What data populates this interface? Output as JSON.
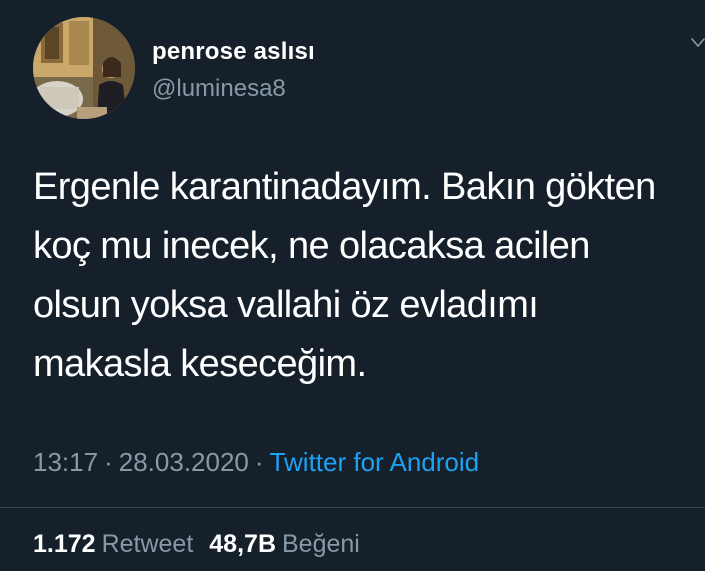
{
  "tweet": {
    "display_name": "penrose aslısı",
    "handle": "@luminesa8",
    "text": "Ergenle karantinadayım. Bakın gökten\nkoç mu inecek, ne olacaksa acilen\nolsun yoksa vallahi öz evladımı\nmakasla keseceğim.",
    "time": "13:17",
    "date": "28.03.2020",
    "separator": "·",
    "source": "Twitter for Android",
    "retweet_count": "1.172",
    "retweet_label": "Retweet",
    "like_count": "48,7B",
    "like_label": "Beğeni"
  },
  "colors": {
    "background": "#15202b",
    "text_primary": "#ffffff",
    "text_secondary": "#8899a6",
    "link": "#1da1f2",
    "divider": "#38444d"
  },
  "icons": {
    "more": "chevron-down-icon",
    "avatar": "profile-photo"
  }
}
